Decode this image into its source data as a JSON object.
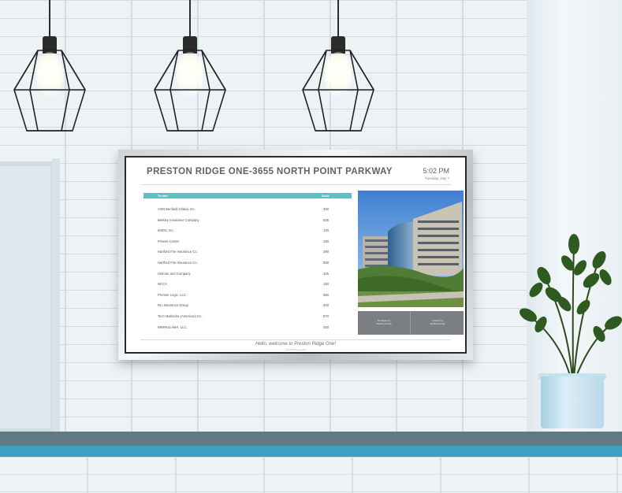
{
  "signage": {
    "building_title": "PRESTON RIDGE ONE-3655 NORTH POINT PARKWAY",
    "time": "5:02 PM",
    "date": "Tuesday, July 7",
    "column_tenant": "Tenant",
    "column_suite": "Suite",
    "tenants": [
      {
        "name": "AON Benfield Global, Inc.",
        "suite": "300"
      },
      {
        "name": "Berkley Insurance Company",
        "suite": "635"
      },
      {
        "name": "eMDS, Inc.",
        "suite": "140"
      },
      {
        "name": "Fitness Center",
        "suite": "180"
      },
      {
        "name": "Hartford Fire Insurance Co.",
        "suite": "390"
      },
      {
        "name": "Hartford Fire Insurance Co.",
        "suite": "500"
      },
      {
        "name": "Holman and Company",
        "suite": "425"
      },
      {
        "name": "NCCA",
        "suite": "150"
      },
      {
        "name": "Premier Logic, LLC",
        "suite": "650"
      },
      {
        "name": "RLI Insurance Group",
        "suite": "400"
      },
      {
        "name": "Tech Mahindra (Americas) Inc.",
        "suite": "670"
      },
      {
        "name": "WERKLLAMA, LLC.",
        "suite": "450"
      }
    ],
    "panel_left": "Managed by\nStarling Realty",
    "panel_right": "Leased by\nStarling Realty",
    "welcome": "Hello, welcome to Preston Ridge One!",
    "url": "www.TouchSource.com"
  },
  "colors": {
    "accent": "#58c2c4",
    "counter_edge": "#3e9fc4",
    "panel": "#7b7f83"
  },
  "icons": [
    "pendant-lamp-icon",
    "plant-icon"
  ]
}
